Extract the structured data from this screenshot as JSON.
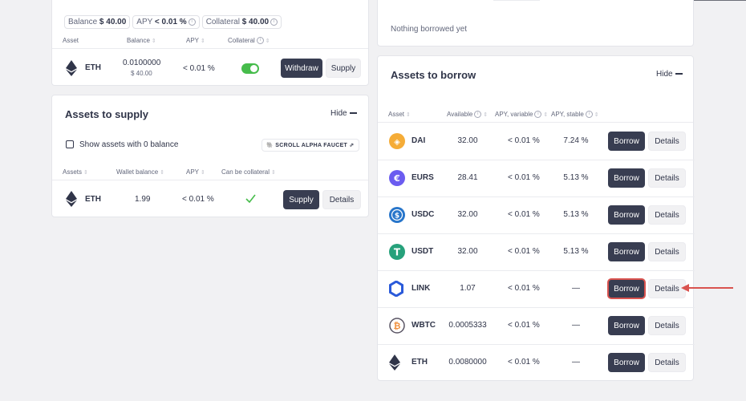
{
  "supplies": {
    "balance_label": "Balance",
    "balance_value": "$ 40.00",
    "apy_label": "APY",
    "apy_value": "< 0.01 %",
    "collateral_label": "Collateral",
    "collateral_value": "$ 40.00",
    "headers": [
      "Asset",
      "Balance",
      "APY",
      "Collateral"
    ],
    "row": {
      "symbol": "ETH",
      "balance": "0.0100000",
      "balance_usd": "$ 40.00",
      "apy": "< 0.01 %",
      "withdraw_label": "Withdraw",
      "supply_label": "Supply"
    }
  },
  "assets_to_supply": {
    "title": "Assets to supply",
    "hide_label": "Hide",
    "show_zero_label": "Show assets with 0 balance",
    "faucet_label": "SCROLL ALPHA FAUCET",
    "headers": [
      "Assets",
      "Wallet balance",
      "APY",
      "Can be collateral"
    ],
    "row": {
      "symbol": "ETH",
      "wallet_balance": "1.99",
      "apy": "< 0.01 %",
      "supply_label": "Supply",
      "details_label": "Details"
    }
  },
  "borrows": {
    "empty_text": "Nothing borrowed yet"
  },
  "assets_to_borrow": {
    "title": "Assets to borrow",
    "hide_label": "Hide",
    "headers": [
      "Asset",
      "Available",
      "APY, variable",
      "APY, stable"
    ],
    "borrow_label": "Borrow",
    "details_label": "Details",
    "rows": [
      {
        "symbol": "DAI",
        "available": "32.00",
        "apy_variable": "< 0.01 %",
        "apy_stable": "7.24 %",
        "icon": "dai-icon",
        "color": "#f5ac37"
      },
      {
        "symbol": "EURS",
        "available": "28.41",
        "apy_variable": "< 0.01 %",
        "apy_stable": "5.13 %",
        "icon": "eurs-icon",
        "color": "#6b5cf0"
      },
      {
        "symbol": "USDC",
        "available": "32.00",
        "apy_variable": "< 0.01 %",
        "apy_stable": "5.13 %",
        "icon": "usdc-icon",
        "color": "#2775ca"
      },
      {
        "symbol": "USDT",
        "available": "32.00",
        "apy_variable": "< 0.01 %",
        "apy_stable": "5.13 %",
        "icon": "usdt-icon",
        "color": "#26a17b"
      },
      {
        "symbol": "LINK",
        "available": "1.07",
        "apy_variable": "< 0.01 %",
        "apy_stable": "—",
        "icon": "link-icon",
        "color": "#2a5ada"
      },
      {
        "symbol": "WBTC",
        "available": "0.0005333",
        "apy_variable": "< 0.01 %",
        "apy_stable": "—",
        "icon": "wbtc-icon",
        "color": "#f09242"
      },
      {
        "symbol": "ETH",
        "available": "0.0080000",
        "apy_variable": "< 0.01 %",
        "apy_stable": "—",
        "icon": "eth-icon",
        "color": "#303549"
      }
    ]
  },
  "colors": {
    "dark_button": "#383d51",
    "toggle_on": "#46bc4b",
    "highlight": "#d9534f"
  }
}
